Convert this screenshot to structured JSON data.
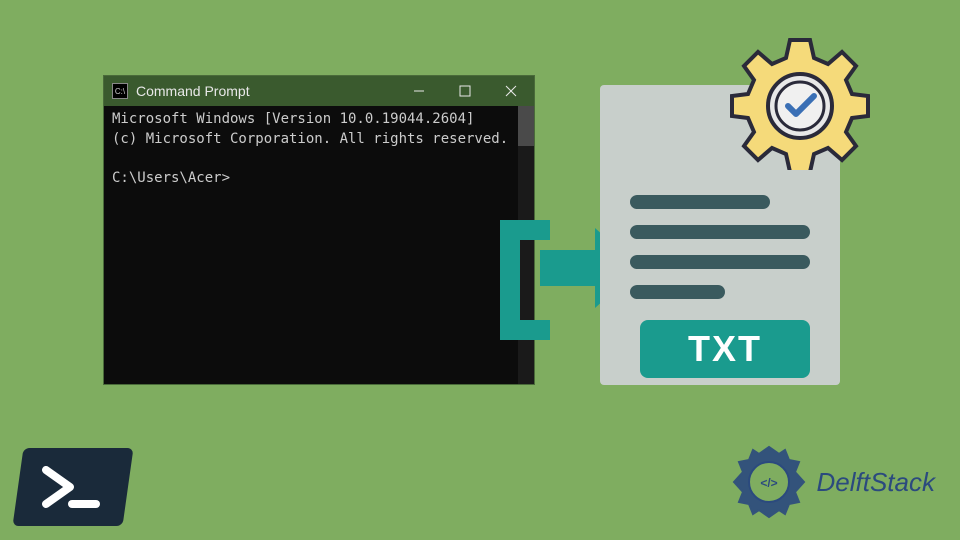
{
  "cmd": {
    "title": "Command Prompt",
    "icon_label": "C:\\",
    "output_line1": "Microsoft Windows [Version 10.0.19044.2604]",
    "output_line2": "(c) Microsoft Corporation. All rights reserved.",
    "prompt": "C:\\Users\\Acer>"
  },
  "doc": {
    "badge": "TXT"
  },
  "branding": {
    "delftstack": "DelftStack"
  },
  "colors": {
    "bg": "#7fad60",
    "teal": "#1a9b8e",
    "cmd_bg": "#0c0c0c",
    "doc_bg": "#c8cfcb"
  }
}
